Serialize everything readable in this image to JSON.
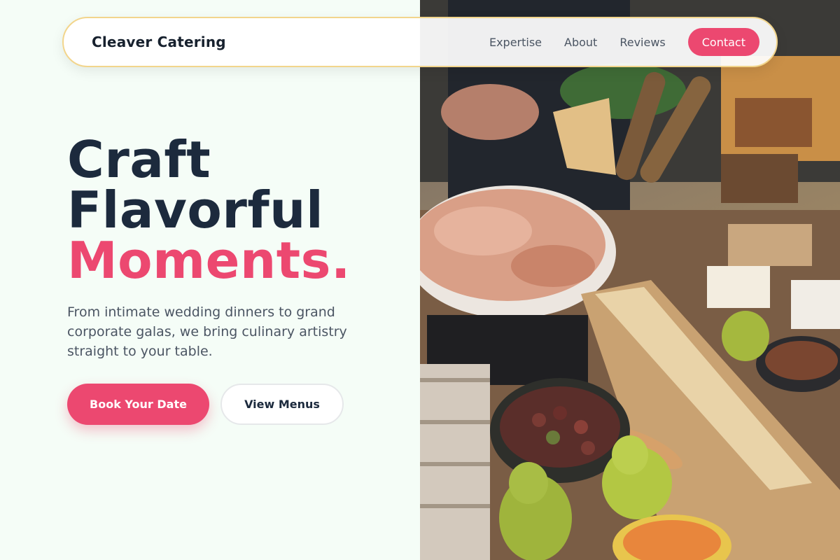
{
  "nav": {
    "brand": "Cleaver Catering",
    "links": [
      "Expertise",
      "About",
      "Reviews"
    ],
    "contact_label": "Contact"
  },
  "hero": {
    "title_line1": "Craft",
    "title_line2": "Flavorful",
    "title_line3": "Moments.",
    "subtitle": "From intimate wedding dinners to grand corporate galas, we bring culinary artistry straight to your table.",
    "primary_cta": "Book Your Date",
    "secondary_cta": "View Menus"
  },
  "colors": {
    "accent": "#ec4870",
    "heading": "#1c2a3d",
    "background": "#f5fdf7",
    "nav_border": "#f2d58c"
  },
  "images": {
    "hero_photo": "catering-grazing-table-photo"
  }
}
